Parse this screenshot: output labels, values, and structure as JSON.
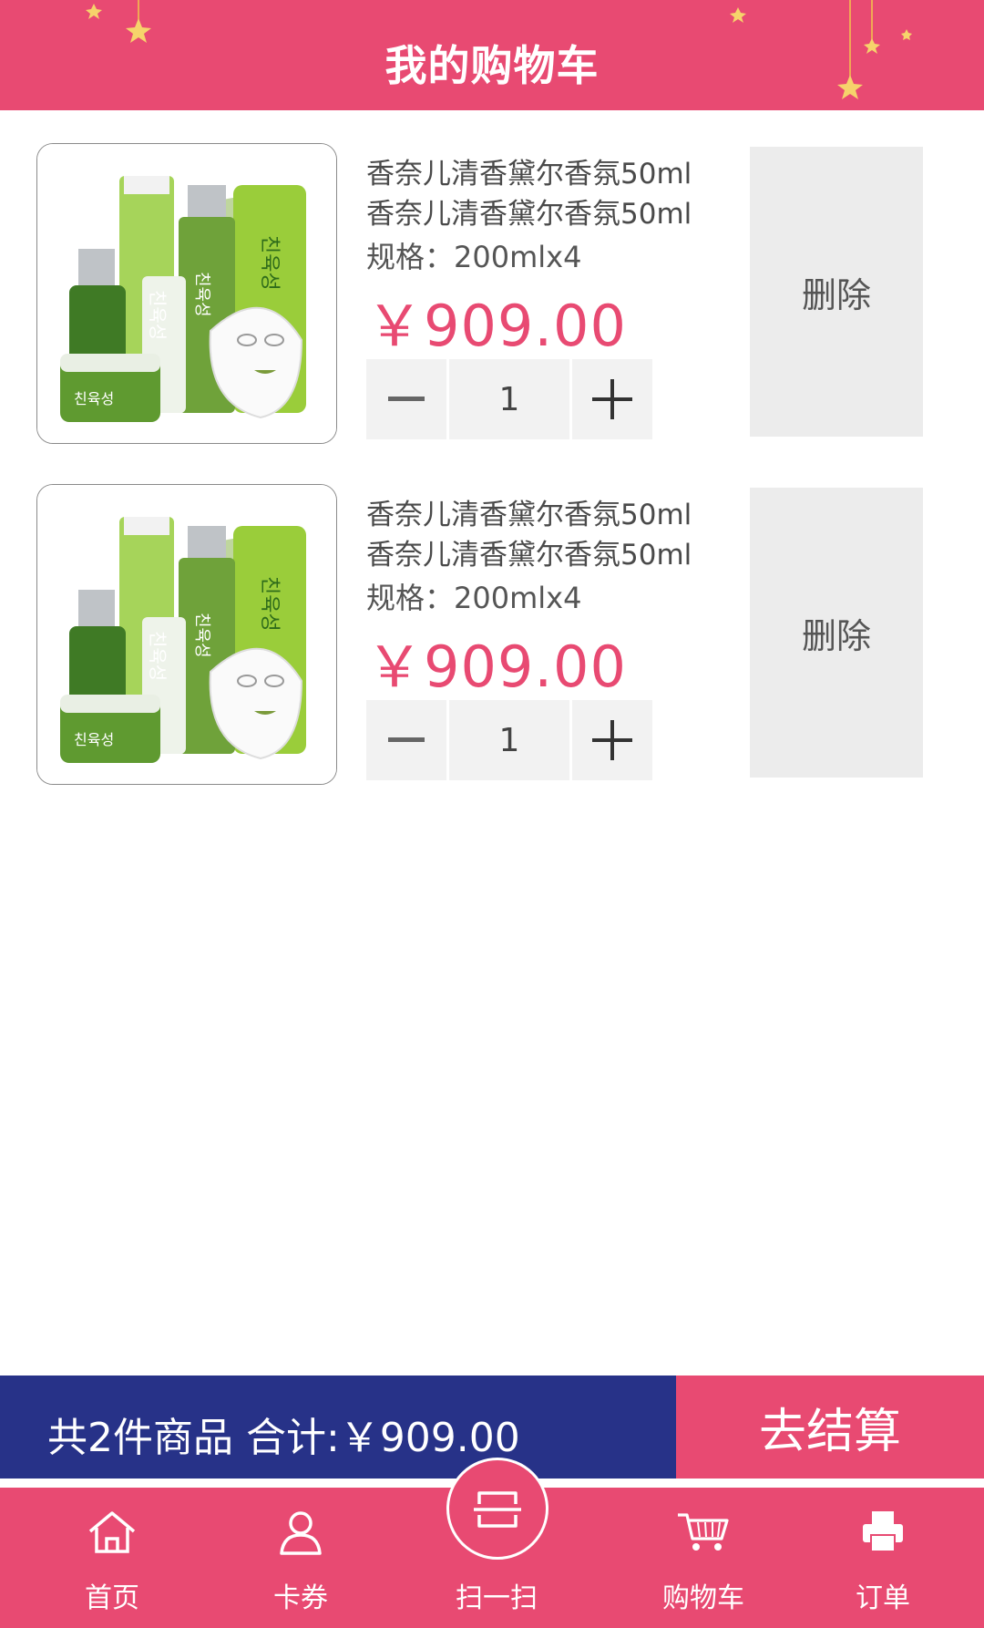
{
  "header": {
    "title": "我的购物车"
  },
  "cart_items": [
    {
      "name_line1": "香奈儿清香黛尔香氛50ml",
      "name_line2": "香奈儿清香黛尔香氛50ml",
      "spec": "规格：200mlx4",
      "price": "￥909.00",
      "quantity": "1",
      "delete_label": "删除",
      "product_labels": [
        "친육성",
        "친육성",
        "친육성",
        "친육성"
      ]
    },
    {
      "name_line1": "香奈儿清香黛尔香氛50ml",
      "name_line2": "香奈儿清香黛尔香氛50ml",
      "spec": "规格：200mlx4",
      "price": "￥909.00",
      "quantity": "1",
      "delete_label": "删除",
      "product_labels": [
        "친육성",
        "친육성",
        "친육성",
        "친육성"
      ]
    }
  ],
  "summary": {
    "text": "共2件商品 合计:￥909.00",
    "checkout_label": "去结算"
  },
  "bottom_nav": {
    "items": [
      {
        "label": "首页",
        "icon": "home-icon"
      },
      {
        "label": "卡券",
        "icon": "user-icon"
      },
      {
        "label": "扫一扫",
        "icon": "scan-icon"
      },
      {
        "label": "购物车",
        "icon": "cart-icon"
      },
      {
        "label": "订单",
        "icon": "printer-icon"
      }
    ]
  },
  "colors": {
    "accent": "#e84a72",
    "summary_bg": "#273288",
    "button_bg": "#ececec"
  }
}
